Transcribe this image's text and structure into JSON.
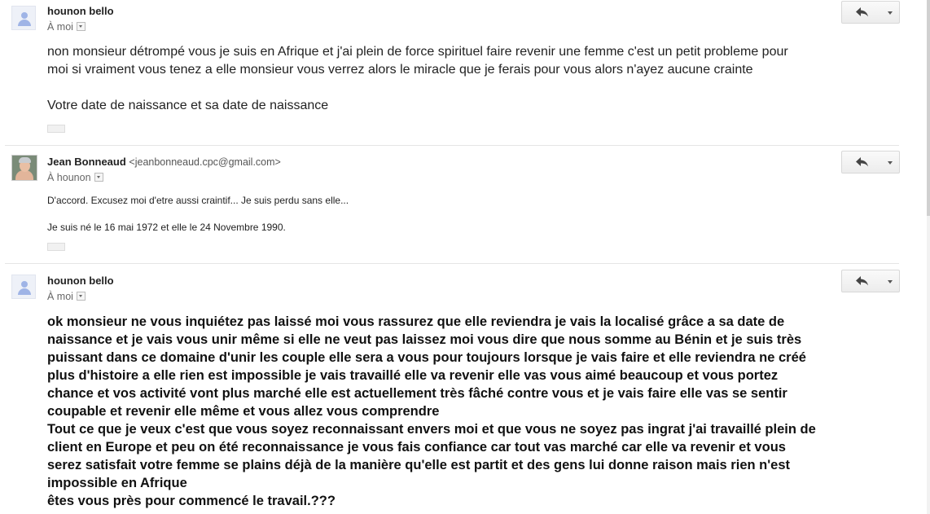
{
  "messages": [
    {
      "sender": "hounon bello",
      "to_label": "À moi",
      "body": [
        "non monsieur détrompé vous je suis en Afrique et j'ai plein de force spirituel faire revenir une femme c'est un petit probleme pour",
        "moi si vraiment vous tenez a elle monsieur vous verrez alors le miracle que je ferais pour vous alors n'ayez aucune crainte",
        "",
        "Votre date de naissance et sa date de naissance"
      ]
    },
    {
      "sender": "Jean Bonneaud",
      "email": "<jeanbonneaud.cpc@gmail.com>",
      "to_label": "À hounon",
      "body": [
        "D'accord. Excusez moi d'etre aussi craintif... Je suis perdu sans elle...",
        "",
        "Je suis né le 16 mai 1972 et elle le 24 Novembre 1990."
      ]
    },
    {
      "sender": "hounon bello",
      "to_label": "À moi",
      "body": [
        "ok monsieur ne vous inquiétez pas laissé moi vous rassurez que elle reviendra je vais la localisé grâce a sa date de",
        "naissance et je vais vous unir même si elle ne veut pas laissez moi vous dire que nous somme au Bénin et je suis très",
        "puissant dans ce domaine d'unir les couple elle sera a vous pour toujours lorsque je vais faire et elle reviendra ne créé",
        "plus d'histoire a elle rien est impossible je vais travaillé elle va revenir elle vas vous aimé beaucoup et vous portez",
        "chance et vos activité vont plus marché elle est actuellement très fâché contre vous et je vais faire elle vas se sentir",
        "coupable et revenir elle même et vous allez vous comprendre",
        "Tout ce que je veux c'est que vous soyez reconnaissant envers moi et que vous ne soyez pas ingrat j'ai travaillé plein de",
        "client en Europe et peu on été reconnaissance je vous fais confiance  car tout vas marché car elle va revenir et vous",
        "serez satisfait votre femme se plains déjà  de la manière qu'elle est partit et des gens lui donne raison   mais rien n'est",
        "impossible  en Afrique",
        "êtes vous près pour commencé le travail.???"
      ]
    }
  ],
  "icons": {
    "reply": "reply-arrow-icon",
    "more": "chevron-down-icon",
    "avatar": "default-avatar-icon"
  },
  "colors": {
    "button_border": "#d8d8d8",
    "avatar_fill": "#9fb4e6",
    "divider": "#e5e5e5"
  }
}
